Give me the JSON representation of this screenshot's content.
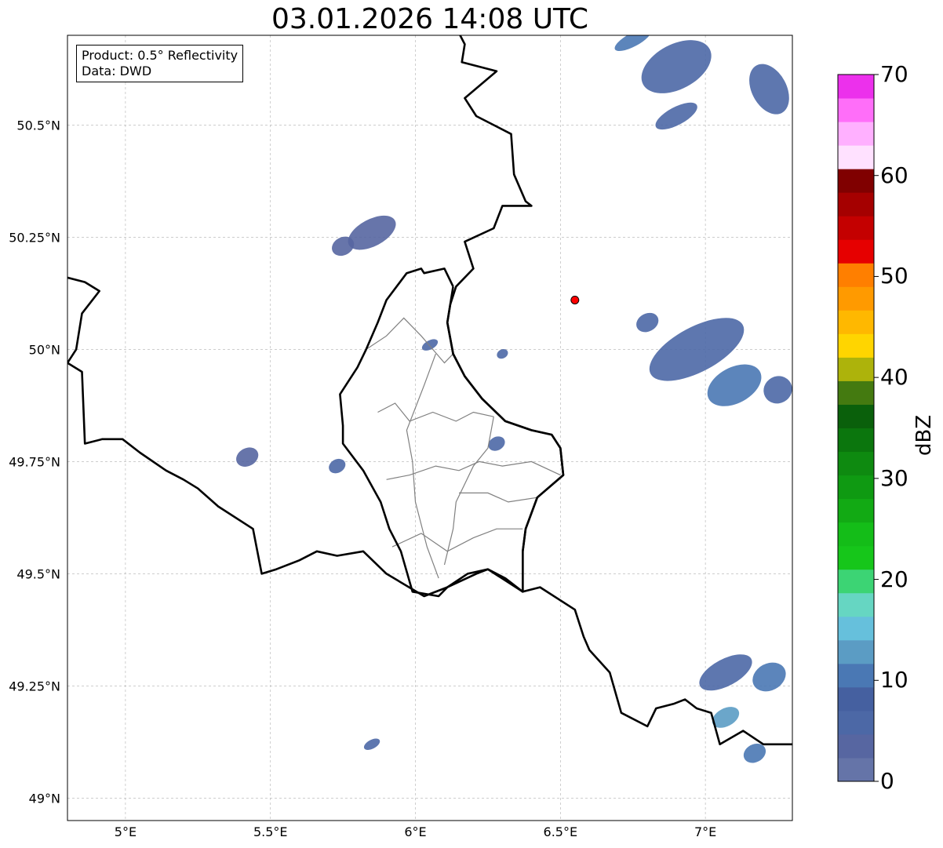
{
  "title": "03.01.2026 14:08 UTC",
  "info": {
    "product": "Product: 0.5° Reflectivity",
    "data": "Data: DWD"
  },
  "map": {
    "extent": {
      "lon_min": 4.8,
      "lon_max": 7.3,
      "lat_min": 48.95,
      "lat_max": 50.7
    },
    "x_ticks": [
      {
        "value": 5.0,
        "label": "5°E"
      },
      {
        "value": 5.5,
        "label": "5.5°E"
      },
      {
        "value": 6.0,
        "label": "6°E"
      },
      {
        "value": 6.5,
        "label": "6.5°E"
      },
      {
        "value": 7.0,
        "label": "7°E"
      }
    ],
    "y_ticks": [
      {
        "value": 49.0,
        "label": "49°N"
      },
      {
        "value": 49.25,
        "label": "49.25°N"
      },
      {
        "value": 49.5,
        "label": "49.5°N"
      },
      {
        "value": 49.75,
        "label": "49.75°N"
      },
      {
        "value": 50.0,
        "label": "50°N"
      },
      {
        "value": 50.25,
        "label": "50.25°N"
      },
      {
        "value": 50.5,
        "label": "50.5°N"
      }
    ],
    "radar_site": {
      "lon": 6.55,
      "lat": 50.11,
      "color": "#ff0000"
    },
    "grid": true,
    "border_color": "#000000",
    "region_border_color": "#808080",
    "national_borders": [
      [
        [
          6.13,
          50.73
        ],
        [
          6.17,
          50.68
        ],
        [
          6.16,
          50.64
        ],
        [
          6.28,
          50.62
        ],
        [
          6.17,
          50.56
        ],
        [
          6.21,
          50.52
        ],
        [
          6.33,
          50.48
        ],
        [
          6.34,
          50.39
        ],
        [
          6.38,
          50.33
        ],
        [
          6.4,
          50.32
        ],
        [
          6.3,
          50.32
        ],
        [
          6.27,
          50.27
        ],
        [
          6.17,
          50.24
        ],
        [
          6.2,
          50.18
        ],
        [
          6.14,
          50.14
        ],
        [
          6.12,
          50.1
        ],
        [
          6.11,
          50.06
        ],
        [
          6.13,
          49.99
        ],
        [
          6.17,
          49.94
        ],
        [
          6.23,
          49.89
        ],
        [
          6.31,
          49.84
        ],
        [
          6.4,
          49.82
        ],
        [
          6.47,
          49.81
        ],
        [
          6.5,
          49.78
        ],
        [
          6.51,
          49.72
        ],
        [
          6.42,
          49.67
        ],
        [
          6.38,
          49.6
        ],
        [
          6.37,
          49.55
        ],
        [
          6.37,
          49.46
        ],
        [
          6.43,
          49.47
        ],
        [
          6.55,
          49.42
        ],
        [
          6.58,
          49.36
        ],
        [
          6.6,
          49.33
        ],
        [
          6.67,
          49.28
        ],
        [
          6.71,
          49.19
        ],
        [
          6.8,
          49.16
        ],
        [
          6.83,
          49.2
        ],
        [
          6.89,
          49.21
        ],
        [
          6.93,
          49.22
        ],
        [
          6.97,
          49.2
        ],
        [
          7.02,
          49.19
        ],
        [
          7.05,
          49.12
        ],
        [
          7.13,
          49.15
        ],
        [
          7.2,
          49.12
        ],
        [
          7.3,
          49.12
        ]
      ],
      [
        [
          4.8,
          49.97
        ],
        [
          4.85,
          49.95
        ],
        [
          4.86,
          49.79
        ],
        [
          4.92,
          49.8
        ],
        [
          4.99,
          49.8
        ],
        [
          5.05,
          49.77
        ],
        [
          5.14,
          49.73
        ],
        [
          5.2,
          49.71
        ],
        [
          5.25,
          49.69
        ],
        [
          5.32,
          49.65
        ],
        [
          5.44,
          49.6
        ],
        [
          5.47,
          49.5
        ],
        [
          5.52,
          49.51
        ],
        [
          5.6,
          49.53
        ],
        [
          5.66,
          49.55
        ],
        [
          5.73,
          49.54
        ],
        [
          5.82,
          49.55
        ],
        [
          5.9,
          49.5
        ],
        [
          6.03,
          49.45
        ],
        [
          6.11,
          49.47
        ],
        [
          6.18,
          49.5
        ],
        [
          6.25,
          49.51
        ],
        [
          6.31,
          49.49
        ],
        [
          6.37,
          49.46
        ]
      ],
      [
        [
          4.8,
          49.97
        ],
        [
          4.83,
          50.0
        ],
        [
          4.85,
          50.08
        ],
        [
          4.91,
          50.13
        ],
        [
          4.86,
          50.15
        ],
        [
          4.8,
          50.16
        ]
      ],
      [
        [
          6.13,
          50.14
        ],
        [
          6.1,
          50.18
        ],
        [
          6.03,
          50.17
        ],
        [
          6.02,
          50.18
        ],
        [
          5.97,
          50.17
        ],
        [
          5.9,
          50.11
        ],
        [
          5.87,
          50.06
        ],
        [
          5.83,
          50.0
        ],
        [
          5.8,
          49.96
        ],
        [
          5.74,
          49.9
        ],
        [
          5.75,
          49.83
        ],
        [
          5.75,
          49.79
        ],
        [
          5.82,
          49.73
        ],
        [
          5.88,
          49.66
        ],
        [
          5.91,
          49.6
        ],
        [
          5.95,
          49.55
        ],
        [
          5.99,
          49.46
        ],
        [
          6.08,
          49.45
        ],
        [
          6.11,
          49.47
        ],
        [
          6.21,
          49.5
        ],
        [
          6.25,
          49.51
        ],
        [
          6.37,
          49.46
        ],
        [
          6.37,
          49.55
        ],
        [
          6.38,
          49.6
        ],
        [
          6.42,
          49.67
        ],
        [
          6.51,
          49.72
        ],
        [
          6.5,
          49.78
        ],
        [
          6.47,
          49.81
        ],
        [
          6.4,
          49.82
        ],
        [
          6.31,
          49.84
        ],
        [
          6.23,
          49.89
        ],
        [
          6.17,
          49.94
        ],
        [
          6.13,
          49.99
        ],
        [
          6.11,
          50.06
        ],
        [
          6.12,
          50.1
        ],
        [
          6.13,
          50.14
        ]
      ]
    ],
    "region_borders": [
      [
        [
          5.83,
          50.0
        ],
        [
          5.9,
          50.03
        ],
        [
          5.96,
          50.07
        ],
        [
          6.02,
          50.03
        ],
        [
          6.06,
          50.0
        ],
        [
          6.1,
          49.97
        ],
        [
          6.13,
          49.99
        ]
      ],
      [
        [
          5.87,
          49.86
        ],
        [
          5.93,
          49.88
        ],
        [
          5.98,
          49.84
        ],
        [
          6.06,
          49.86
        ],
        [
          6.14,
          49.84
        ],
        [
          6.2,
          49.86
        ],
        [
          6.27,
          49.85
        ]
      ],
      [
        [
          6.07,
          49.99
        ],
        [
          6.03,
          49.92
        ],
        [
          5.97,
          49.82
        ],
        [
          5.99,
          49.75
        ],
        [
          6.0,
          49.66
        ],
        [
          6.04,
          49.56
        ],
        [
          6.08,
          49.49
        ]
      ],
      [
        [
          6.27,
          49.85
        ],
        [
          6.25,
          49.78
        ],
        [
          6.2,
          49.74
        ],
        [
          6.17,
          49.7
        ],
        [
          6.14,
          49.66
        ],
        [
          6.13,
          49.6
        ],
        [
          6.1,
          49.52
        ]
      ],
      [
        [
          5.9,
          49.71
        ],
        [
          5.98,
          49.72
        ],
        [
          6.07,
          49.74
        ],
        [
          6.15,
          49.73
        ],
        [
          6.22,
          49.75
        ],
        [
          6.3,
          49.74
        ],
        [
          6.4,
          49.75
        ],
        [
          6.5,
          49.72
        ]
      ],
      [
        [
          5.92,
          49.56
        ],
        [
          6.02,
          49.59
        ],
        [
          6.11,
          49.55
        ],
        [
          6.2,
          49.58
        ],
        [
          6.28,
          49.6
        ],
        [
          6.37,
          49.6
        ]
      ],
      [
        [
          6.15,
          49.68
        ],
        [
          6.25,
          49.68
        ],
        [
          6.32,
          49.66
        ],
        [
          6.42,
          49.67
        ]
      ]
    ],
    "echo_cells": [
      {
        "lon": 6.9,
        "lat": 50.63,
        "rx": 0.13,
        "ry": 0.05,
        "dbz": 5
      },
      {
        "lon": 7.22,
        "lat": 50.58,
        "rx": 0.06,
        "ry": 0.06,
        "dbz": 7
      },
      {
        "lon": 6.75,
        "lat": 50.69,
        "rx": 0.07,
        "ry": 0.015,
        "dbz": 10
      },
      {
        "lon": 6.9,
        "lat": 50.52,
        "rx": 0.08,
        "ry": 0.02,
        "dbz": 5
      },
      {
        "lon": 5.85,
        "lat": 50.26,
        "rx": 0.09,
        "ry": 0.03,
        "dbz": 4
      },
      {
        "lon": 5.75,
        "lat": 50.23,
        "rx": 0.04,
        "ry": 0.02,
        "dbz": 4
      },
      {
        "lon": 5.42,
        "lat": 49.76,
        "rx": 0.04,
        "ry": 0.02,
        "dbz": 4
      },
      {
        "lon": 5.73,
        "lat": 49.74,
        "rx": 0.03,
        "ry": 0.015,
        "dbz": 5
      },
      {
        "lon": 6.28,
        "lat": 49.79,
        "rx": 0.03,
        "ry": 0.015,
        "dbz": 7
      },
      {
        "lon": 6.97,
        "lat": 50.0,
        "rx": 0.18,
        "ry": 0.05,
        "dbz": 6
      },
      {
        "lon": 7.1,
        "lat": 49.92,
        "rx": 0.1,
        "ry": 0.04,
        "dbz": 12
      },
      {
        "lon": 7.25,
        "lat": 49.91,
        "rx": 0.05,
        "ry": 0.03,
        "dbz": 5
      },
      {
        "lon": 6.8,
        "lat": 50.06,
        "rx": 0.04,
        "ry": 0.02,
        "dbz": 5
      },
      {
        "lon": 7.07,
        "lat": 49.28,
        "rx": 0.1,
        "ry": 0.03,
        "dbz": 5
      },
      {
        "lon": 7.22,
        "lat": 49.27,
        "rx": 0.06,
        "ry": 0.03,
        "dbz": 10
      },
      {
        "lon": 7.07,
        "lat": 49.18,
        "rx": 0.05,
        "ry": 0.02,
        "dbz": 14
      },
      {
        "lon": 7.17,
        "lat": 49.1,
        "rx": 0.04,
        "ry": 0.02,
        "dbz": 10
      },
      {
        "lon": 5.85,
        "lat": 49.12,
        "rx": 0.03,
        "ry": 0.01,
        "dbz": 5
      },
      {
        "lon": 6.05,
        "lat": 50.01,
        "rx": 0.03,
        "ry": 0.01,
        "dbz": 5
      },
      {
        "lon": 6.3,
        "lat": 49.99,
        "rx": 0.02,
        "ry": 0.01,
        "dbz": 5
      }
    ]
  },
  "colorbar": {
    "label": "dBZ",
    "tick_labels": [
      "0",
      "10",
      "20",
      "30",
      "40",
      "50",
      "60",
      "70"
    ],
    "min": 0,
    "max": 70,
    "step": 2.5,
    "colors": [
      "#6574a8",
      "#5766a1",
      "#4c68a6",
      "#4560a0",
      "#4a78b4",
      "#5b9cc4",
      "#66c0dc",
      "#66d6c2",
      "#3cd474",
      "#16c61a",
      "#14bd18",
      "#12aa14",
      "#0f9a12",
      "#0e8a10",
      "#0b760d",
      "#0a600b",
      "#447a10",
      "#adb30b",
      "#ffd500",
      "#ffb800",
      "#ff9a00",
      "#ff7f00",
      "#e60000",
      "#c40000",
      "#a50000",
      "#800000",
      "#ffe1ff",
      "#ffb0ff",
      "#ff6ef9",
      "#ec30ec"
    ]
  }
}
